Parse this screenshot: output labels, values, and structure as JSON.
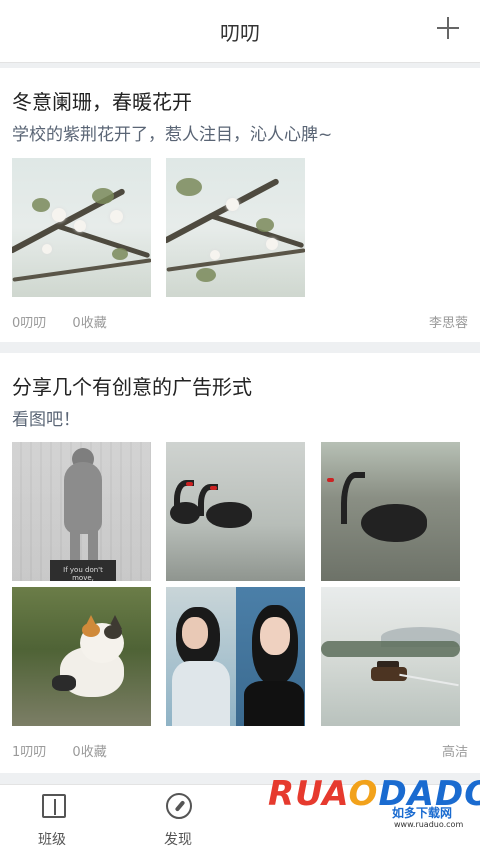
{
  "header": {
    "title": "叨叨"
  },
  "posts": [
    {
      "title": "冬意阑珊，春暖花开",
      "subtitle": "学校的紫荆花开了，惹人注目，沁人心脾~",
      "likes": "0叨叨",
      "favorites": "0收藏",
      "author": "李思蓉"
    },
    {
      "title": "分享几个有创意的广告形式",
      "subtitle": "看图吧！",
      "statue_caption": "If you don't move,",
      "likes": "1叨叨",
      "favorites": "0收藏",
      "author": "高洁"
    }
  ],
  "tabbar": {
    "class_label": "班级",
    "discover_label": "发现"
  },
  "watermark": {
    "brand": "RUANDADO",
    "brand_parts": [
      "RU",
      "A",
      "O",
      "DADO"
    ],
    "sub": "如多下载网",
    "url": "www.ruaduo.com"
  },
  "colors": {
    "subtitle": "#5a6575",
    "meta": "#9a9a9a",
    "background": "#eef0f2"
  }
}
